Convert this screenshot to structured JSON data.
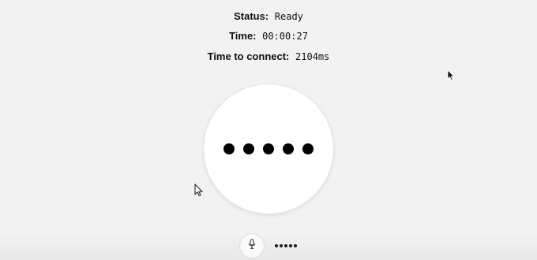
{
  "status": {
    "status_label": "Status:",
    "status_value": "Ready",
    "time_label": "Time:",
    "time_value": "00:00:27",
    "connect_label": "Time to connect:",
    "connect_value": "2104ms"
  },
  "orb": {
    "state": "connecting",
    "dot_count": 5
  },
  "bottom": {
    "mic_icon": "microphone-icon",
    "indicator_dot_count": 5
  },
  "colors": {
    "background": "#f2f2f2",
    "orb": "#ffffff",
    "dots": "#000000"
  }
}
